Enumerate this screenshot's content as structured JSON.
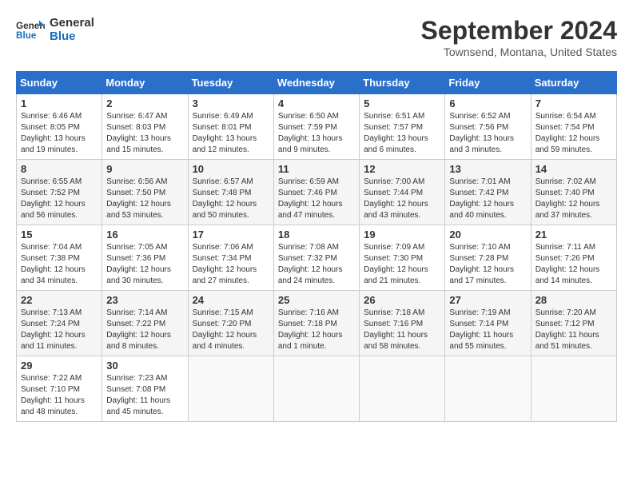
{
  "header": {
    "logo_line1": "General",
    "logo_line2": "Blue",
    "month": "September 2024",
    "location": "Townsend, Montana, United States"
  },
  "weekdays": [
    "Sunday",
    "Monday",
    "Tuesday",
    "Wednesday",
    "Thursday",
    "Friday",
    "Saturday"
  ],
  "weeks": [
    [
      {
        "day": "1",
        "info": "Sunrise: 6:46 AM\nSunset: 8:05 PM\nDaylight: 13 hours\nand 19 minutes."
      },
      {
        "day": "2",
        "info": "Sunrise: 6:47 AM\nSunset: 8:03 PM\nDaylight: 13 hours\nand 15 minutes."
      },
      {
        "day": "3",
        "info": "Sunrise: 6:49 AM\nSunset: 8:01 PM\nDaylight: 13 hours\nand 12 minutes."
      },
      {
        "day": "4",
        "info": "Sunrise: 6:50 AM\nSunset: 7:59 PM\nDaylight: 13 hours\nand 9 minutes."
      },
      {
        "day": "5",
        "info": "Sunrise: 6:51 AM\nSunset: 7:57 PM\nDaylight: 13 hours\nand 6 minutes."
      },
      {
        "day": "6",
        "info": "Sunrise: 6:52 AM\nSunset: 7:56 PM\nDaylight: 13 hours\nand 3 minutes."
      },
      {
        "day": "7",
        "info": "Sunrise: 6:54 AM\nSunset: 7:54 PM\nDaylight: 12 hours\nand 59 minutes."
      }
    ],
    [
      {
        "day": "8",
        "info": "Sunrise: 6:55 AM\nSunset: 7:52 PM\nDaylight: 12 hours\nand 56 minutes."
      },
      {
        "day": "9",
        "info": "Sunrise: 6:56 AM\nSunset: 7:50 PM\nDaylight: 12 hours\nand 53 minutes."
      },
      {
        "day": "10",
        "info": "Sunrise: 6:57 AM\nSunset: 7:48 PM\nDaylight: 12 hours\nand 50 minutes."
      },
      {
        "day": "11",
        "info": "Sunrise: 6:59 AM\nSunset: 7:46 PM\nDaylight: 12 hours\nand 47 minutes."
      },
      {
        "day": "12",
        "info": "Sunrise: 7:00 AM\nSunset: 7:44 PM\nDaylight: 12 hours\nand 43 minutes."
      },
      {
        "day": "13",
        "info": "Sunrise: 7:01 AM\nSunset: 7:42 PM\nDaylight: 12 hours\nand 40 minutes."
      },
      {
        "day": "14",
        "info": "Sunrise: 7:02 AM\nSunset: 7:40 PM\nDaylight: 12 hours\nand 37 minutes."
      }
    ],
    [
      {
        "day": "15",
        "info": "Sunrise: 7:04 AM\nSunset: 7:38 PM\nDaylight: 12 hours\nand 34 minutes."
      },
      {
        "day": "16",
        "info": "Sunrise: 7:05 AM\nSunset: 7:36 PM\nDaylight: 12 hours\nand 30 minutes."
      },
      {
        "day": "17",
        "info": "Sunrise: 7:06 AM\nSunset: 7:34 PM\nDaylight: 12 hours\nand 27 minutes."
      },
      {
        "day": "18",
        "info": "Sunrise: 7:08 AM\nSunset: 7:32 PM\nDaylight: 12 hours\nand 24 minutes."
      },
      {
        "day": "19",
        "info": "Sunrise: 7:09 AM\nSunset: 7:30 PM\nDaylight: 12 hours\nand 21 minutes."
      },
      {
        "day": "20",
        "info": "Sunrise: 7:10 AM\nSunset: 7:28 PM\nDaylight: 12 hours\nand 17 minutes."
      },
      {
        "day": "21",
        "info": "Sunrise: 7:11 AM\nSunset: 7:26 PM\nDaylight: 12 hours\nand 14 minutes."
      }
    ],
    [
      {
        "day": "22",
        "info": "Sunrise: 7:13 AM\nSunset: 7:24 PM\nDaylight: 12 hours\nand 11 minutes."
      },
      {
        "day": "23",
        "info": "Sunrise: 7:14 AM\nSunset: 7:22 PM\nDaylight: 12 hours\nand 8 minutes."
      },
      {
        "day": "24",
        "info": "Sunrise: 7:15 AM\nSunset: 7:20 PM\nDaylight: 12 hours\nand 4 minutes."
      },
      {
        "day": "25",
        "info": "Sunrise: 7:16 AM\nSunset: 7:18 PM\nDaylight: 12 hours\nand 1 minute."
      },
      {
        "day": "26",
        "info": "Sunrise: 7:18 AM\nSunset: 7:16 PM\nDaylight: 11 hours\nand 58 minutes."
      },
      {
        "day": "27",
        "info": "Sunrise: 7:19 AM\nSunset: 7:14 PM\nDaylight: 11 hours\nand 55 minutes."
      },
      {
        "day": "28",
        "info": "Sunrise: 7:20 AM\nSunset: 7:12 PM\nDaylight: 11 hours\nand 51 minutes."
      }
    ],
    [
      {
        "day": "29",
        "info": "Sunrise: 7:22 AM\nSunset: 7:10 PM\nDaylight: 11 hours\nand 48 minutes."
      },
      {
        "day": "30",
        "info": "Sunrise: 7:23 AM\nSunset: 7:08 PM\nDaylight: 11 hours\nand 45 minutes."
      },
      {
        "day": "",
        "info": ""
      },
      {
        "day": "",
        "info": ""
      },
      {
        "day": "",
        "info": ""
      },
      {
        "day": "",
        "info": ""
      },
      {
        "day": "",
        "info": ""
      }
    ]
  ]
}
